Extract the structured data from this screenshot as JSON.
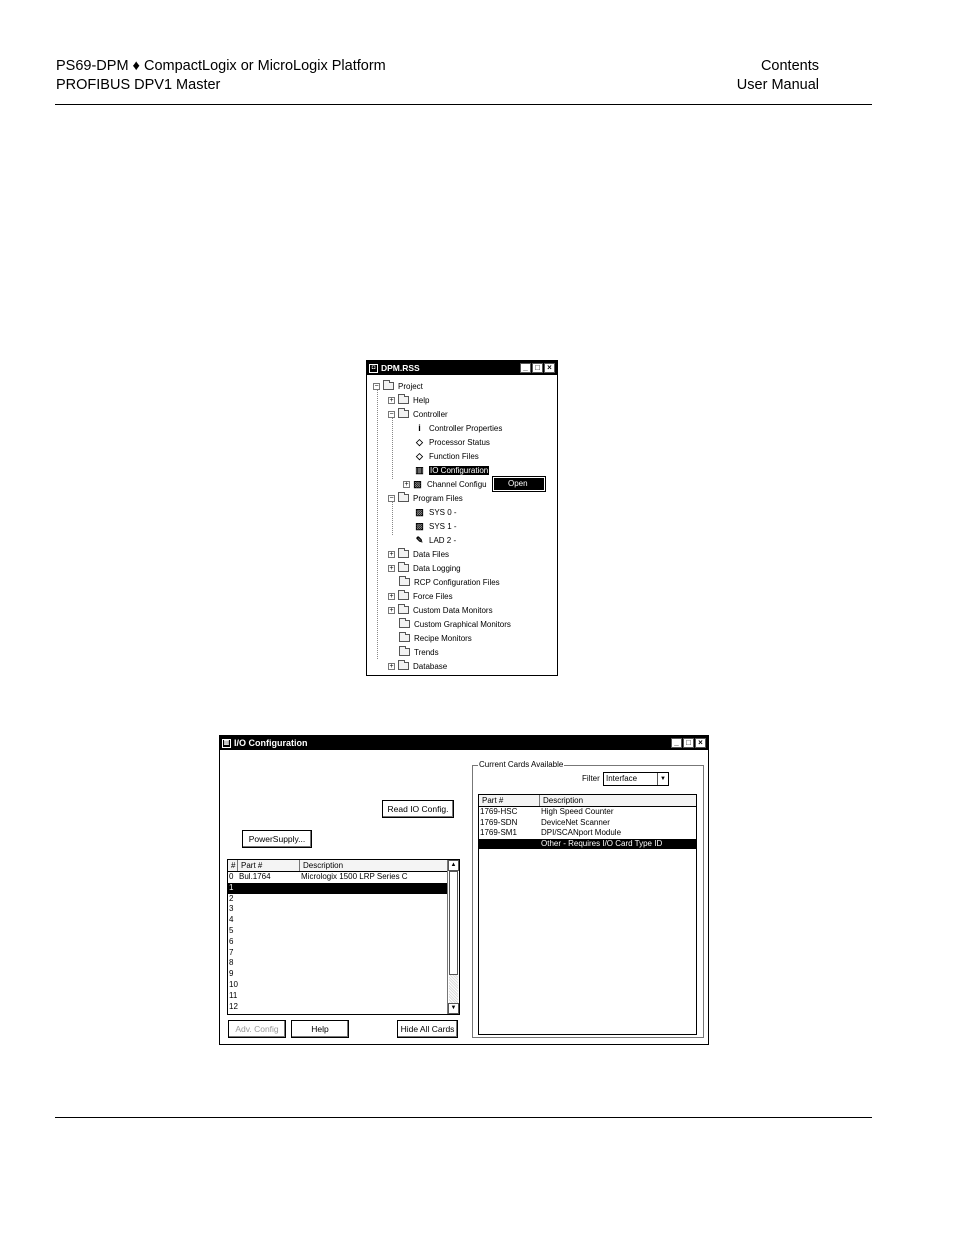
{
  "header": {
    "left_line1": "PS69-DPM ♦ CompactLogix or MicroLogix Platform",
    "left_line2": "PROFIBUS DPV1 Master",
    "right_line1": "Contents",
    "right_line2": "User Manual"
  },
  "tree_window": {
    "title": "DPM.RSS",
    "items": [
      {
        "label": "Project"
      },
      {
        "label": "Help"
      },
      {
        "label": "Controller"
      },
      {
        "label": "Controller Properties"
      },
      {
        "label": "Processor Status"
      },
      {
        "label": "Function Files"
      },
      {
        "label": "IO Configuration"
      },
      {
        "label": "Channel Configu"
      },
      {
        "label": "Program Files"
      },
      {
        "label": "SYS 0 -"
      },
      {
        "label": "SYS 1 -"
      },
      {
        "label": "LAD 2 -"
      },
      {
        "label": "Data Files"
      },
      {
        "label": "Data Logging"
      },
      {
        "label": "RCP Configuration Files"
      },
      {
        "label": "Force Files"
      },
      {
        "label": "Custom Data Monitors"
      },
      {
        "label": "Custom Graphical Monitors"
      },
      {
        "label": "Recipe Monitors"
      },
      {
        "label": "Trends"
      },
      {
        "label": "Database"
      }
    ],
    "context_menu": {
      "open_label": "Open"
    }
  },
  "io_window": {
    "title": "I/O Configuration",
    "read_io_config": "Read IO Config.",
    "power_supply": "PowerSupply...",
    "slot_headers": {
      "num": "#",
      "part": "Part #",
      "desc": "Description"
    },
    "slots": [
      {
        "num": "0",
        "part": "Bul.1764",
        "desc": "Micrologix 1500 LRP Series C"
      },
      {
        "num": "1",
        "part": "",
        "desc": ""
      },
      {
        "num": "2",
        "part": "",
        "desc": ""
      },
      {
        "num": "3",
        "part": "",
        "desc": ""
      },
      {
        "num": "4",
        "part": "",
        "desc": ""
      },
      {
        "num": "5",
        "part": "",
        "desc": ""
      },
      {
        "num": "6",
        "part": "",
        "desc": ""
      },
      {
        "num": "7",
        "part": "",
        "desc": ""
      },
      {
        "num": "8",
        "part": "",
        "desc": ""
      },
      {
        "num": "9",
        "part": "",
        "desc": ""
      },
      {
        "num": "10",
        "part": "",
        "desc": ""
      },
      {
        "num": "11",
        "part": "",
        "desc": ""
      },
      {
        "num": "12",
        "part": "",
        "desc": ""
      }
    ],
    "adv_config": "Adv. Config",
    "help": "Help",
    "hide_all_cards": "Hide All Cards",
    "cards_group_label": "Current Cards Available",
    "filter_label": "Filter",
    "filter_value": "Interface",
    "card_headers": {
      "part": "Part #",
      "desc": "Description"
    },
    "cards": [
      {
        "part": "1769-HSC",
        "desc": "High Speed Counter"
      },
      {
        "part": "1769-SDN",
        "desc": "DeviceNet Scanner"
      },
      {
        "part": "1769-SM1",
        "desc": "DPI/SCANport Module"
      },
      {
        "part": "",
        "desc": "Other - Requires I/O Card Type ID"
      }
    ]
  }
}
